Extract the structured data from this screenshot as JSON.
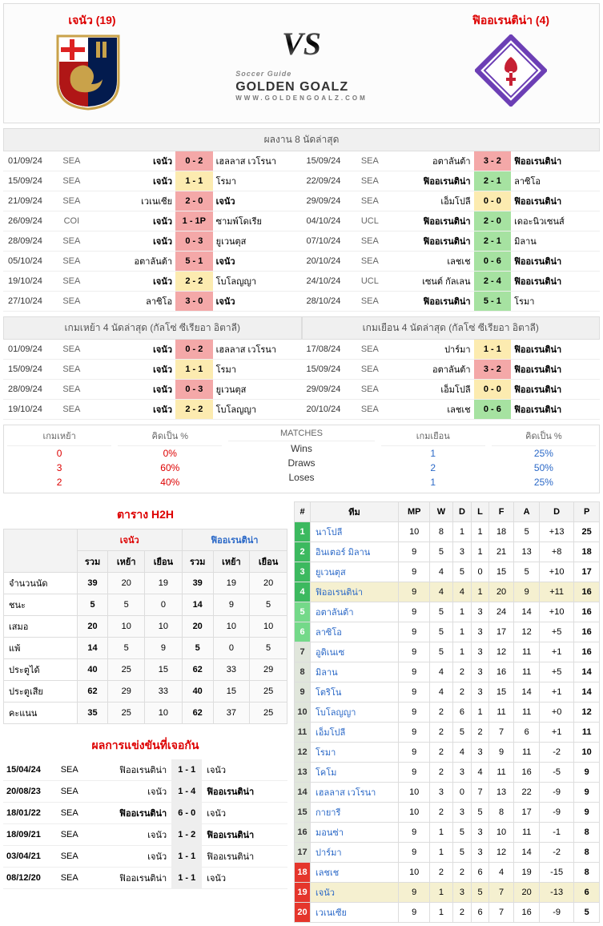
{
  "header": {
    "home_name": "เจนัว (19)",
    "away_name": "ฟิออเรนติน่า (4)",
    "vs": "VS",
    "site": "GOLDEN GOALZ",
    "site_sub": "WWW.GOLDENGOALZ.COM",
    "soccer_guide": "Soccer Guide"
  },
  "sections": {
    "last8": "ผลงาน 8 นัดล่าสุด",
    "home4": "เกมเหย้า 4 นัดล่าสุด (กัลโซ่ ซีเรียอา อิตาลี)",
    "away4": "เกมเยือน 4 นัดล่าสุด (กัลโซ่ ซีเรียอา อิตาลี)",
    "h2h_title": "ตาราง H2H",
    "h2h_matches_title": "ผลการแข่งขันที่เจอกัน"
  },
  "last8": {
    "home": [
      {
        "date": "01/09/24",
        "comp": "SEA",
        "l": "เจนัว",
        "s": "0 - 2",
        "r": "เฮลลาส เวโรนา",
        "cls": "s-red",
        "bold": "l"
      },
      {
        "date": "15/09/24",
        "comp": "SEA",
        "l": "เจนัว",
        "s": "1 - 1",
        "r": "โรมา",
        "cls": "s-yellow",
        "bold": "l"
      },
      {
        "date": "21/09/24",
        "comp": "SEA",
        "l": "เวเนเซีย",
        "s": "2 - 0",
        "r": "เจนัว",
        "cls": "s-red",
        "bold": "r"
      },
      {
        "date": "26/09/24",
        "comp": "COI",
        "l": "เจนัว",
        "s": "1 - 1P",
        "r": "ซามพ์โดเรีย",
        "cls": "s-red",
        "bold": "l"
      },
      {
        "date": "28/09/24",
        "comp": "SEA",
        "l": "เจนัว",
        "s": "0 - 3",
        "r": "ยูเวนตุส",
        "cls": "s-red",
        "bold": "l"
      },
      {
        "date": "05/10/24",
        "comp": "SEA",
        "l": "อตาลันต้า",
        "s": "5 - 1",
        "r": "เจนัว",
        "cls": "s-red",
        "bold": "r"
      },
      {
        "date": "19/10/24",
        "comp": "SEA",
        "l": "เจนัว",
        "s": "2 - 2",
        "r": "โบโลญญา",
        "cls": "s-yellow",
        "bold": "l"
      },
      {
        "date": "27/10/24",
        "comp": "SEA",
        "l": "ลาซิโอ",
        "s": "3 - 0",
        "r": "เจนัว",
        "cls": "s-red",
        "bold": "r"
      }
    ],
    "away": [
      {
        "date": "15/09/24",
        "comp": "SEA",
        "l": "อตาลันต้า",
        "s": "3 - 2",
        "r": "ฟิออเรนติน่า",
        "cls": "s-red",
        "bold": "r"
      },
      {
        "date": "22/09/24",
        "comp": "SEA",
        "l": "ฟิออเรนติน่า",
        "s": "2 - 1",
        "r": "ลาซิโอ",
        "cls": "s-green",
        "bold": "l"
      },
      {
        "date": "29/09/24",
        "comp": "SEA",
        "l": "เอ็มโปลี",
        "s": "0 - 0",
        "r": "ฟิออเรนติน่า",
        "cls": "s-yellow",
        "bold": "r"
      },
      {
        "date": "04/10/24",
        "comp": "UCL",
        "l": "ฟิออเรนติน่า",
        "s": "2 - 0",
        "r": "เดอะนิวเซนส์",
        "cls": "s-green",
        "bold": "l"
      },
      {
        "date": "07/10/24",
        "comp": "SEA",
        "l": "ฟิออเรนติน่า",
        "s": "2 - 1",
        "r": "มิลาน",
        "cls": "s-green",
        "bold": "l"
      },
      {
        "date": "20/10/24",
        "comp": "SEA",
        "l": "เลชเช",
        "s": "0 - 6",
        "r": "ฟิออเรนติน่า",
        "cls": "s-green",
        "bold": "r"
      },
      {
        "date": "24/10/24",
        "comp": "UCL",
        "l": "เซนต์ กัลเลน",
        "s": "2 - 4",
        "r": "ฟิออเรนติน่า",
        "cls": "s-green",
        "bold": "r"
      },
      {
        "date": "28/10/24",
        "comp": "SEA",
        "l": "ฟิออเรนติน่า",
        "s": "5 - 1",
        "r": "โรมา",
        "cls": "s-green",
        "bold": "l"
      }
    ]
  },
  "home4": [
    {
      "date": "01/09/24",
      "comp": "SEA",
      "l": "เจนัว",
      "s": "0 - 2",
      "r": "เฮลลาส เวโรนา",
      "cls": "s-red",
      "bold": "l"
    },
    {
      "date": "15/09/24",
      "comp": "SEA",
      "l": "เจนัว",
      "s": "1 - 1",
      "r": "โรมา",
      "cls": "s-yellow",
      "bold": "l"
    },
    {
      "date": "28/09/24",
      "comp": "SEA",
      "l": "เจนัว",
      "s": "0 - 3",
      "r": "ยูเวนตุส",
      "cls": "s-red",
      "bold": "l"
    },
    {
      "date": "19/10/24",
      "comp": "SEA",
      "l": "เจนัว",
      "s": "2 - 2",
      "r": "โบโลญญา",
      "cls": "s-yellow",
      "bold": "l"
    }
  ],
  "away4": [
    {
      "date": "17/08/24",
      "comp": "SEA",
      "l": "ปาร์มา",
      "s": "1 - 1",
      "r": "ฟิออเรนติน่า",
      "cls": "s-yellow",
      "bold": "r"
    },
    {
      "date": "15/09/24",
      "comp": "SEA",
      "l": "อตาลันต้า",
      "s": "3 - 2",
      "r": "ฟิออเรนติน่า",
      "cls": "s-red",
      "bold": "r"
    },
    {
      "date": "29/09/24",
      "comp": "SEA",
      "l": "เอ็มโปลี",
      "s": "0 - 0",
      "r": "ฟิออเรนติน่า",
      "cls": "s-yellow",
      "bold": "r"
    },
    {
      "date": "20/10/24",
      "comp": "SEA",
      "l": "เลชเช",
      "s": "0 - 6",
      "r": "ฟิออเรนติน่า",
      "cls": "s-green",
      "bold": "r"
    }
  ],
  "summary": {
    "labels": {
      "home": "เกมเหย้า",
      "pct": "คิดเป็น %",
      "matches": "MATCHES",
      "away": "เกมเยือน"
    },
    "rows": [
      {
        "h": "0",
        "hp": "0%",
        "m": "Wins",
        "a": "1",
        "ap": "25%"
      },
      {
        "h": "3",
        "hp": "60%",
        "m": "Draws",
        "a": "2",
        "ap": "50%"
      },
      {
        "h": "2",
        "hp": "40%",
        "m": "Loses",
        "a": "1",
        "ap": "25%"
      }
    ]
  },
  "h2h": {
    "teams": {
      "home": "เจนัว",
      "away": "ฟิออเรนติน่า"
    },
    "cols": {
      "total": "รวม",
      "home": "เหย้า",
      "away": "เยือน"
    },
    "rows": [
      {
        "lbl": "จำนวนนัด",
        "h": [
          "39",
          "20",
          "19"
        ],
        "a": [
          "39",
          "19",
          "20"
        ]
      },
      {
        "lbl": "ชนะ",
        "h": [
          "5",
          "5",
          "0"
        ],
        "a": [
          "14",
          "9",
          "5"
        ]
      },
      {
        "lbl": "เสมอ",
        "h": [
          "20",
          "10",
          "10"
        ],
        "a": [
          "20",
          "10",
          "10"
        ]
      },
      {
        "lbl": "แพ้",
        "h": [
          "14",
          "5",
          "9"
        ],
        "a": [
          "5",
          "0",
          "5"
        ]
      },
      {
        "lbl": "ประตูได้",
        "h": [
          "40",
          "25",
          "15"
        ],
        "a": [
          "62",
          "33",
          "29"
        ]
      },
      {
        "lbl": "ประตูเสีย",
        "h": [
          "62",
          "29",
          "33"
        ],
        "a": [
          "40",
          "15",
          "25"
        ]
      },
      {
        "lbl": "คะแนน",
        "h": [
          "35",
          "25",
          "10"
        ],
        "a": [
          "62",
          "37",
          "25"
        ]
      }
    ]
  },
  "h2h_matches": [
    {
      "date": "15/04/24",
      "comp": "SEA",
      "l": "ฟิออเรนติน่า",
      "s": "1 - 1",
      "r": "เจนัว"
    },
    {
      "date": "20/08/23",
      "comp": "SEA",
      "l": "เจนัว",
      "s": "1 - 4",
      "r": "ฟิออเรนติน่า",
      "rb": true
    },
    {
      "date": "18/01/22",
      "comp": "SEA",
      "l": "ฟิออเรนติน่า",
      "s": "6 - 0",
      "r": "เจนัว",
      "lb": true
    },
    {
      "date": "18/09/21",
      "comp": "SEA",
      "l": "เจนัว",
      "s": "1 - 2",
      "r": "ฟิออเรนติน่า",
      "rb": true
    },
    {
      "date": "03/04/21",
      "comp": "SEA",
      "l": "เจนัว",
      "s": "1 - 1",
      "r": "ฟิออเรนติน่า"
    },
    {
      "date": "08/12/20",
      "comp": "SEA",
      "l": "ฟิออเรนติน่า",
      "s": "1 - 1",
      "r": "เจนัว"
    }
  ],
  "standings": {
    "headers": {
      "pos": "#",
      "team": "ทีม",
      "mp": "MP",
      "w": "W",
      "d": "D",
      "l": "L",
      "f": "F",
      "a": "A",
      "gd": "D",
      "p": "P"
    },
    "rows": [
      {
        "pos": 1,
        "cls": "pos-g",
        "team": "นาโปลี",
        "mp": 10,
        "w": 8,
        "d": 1,
        "l": 1,
        "f": 18,
        "a": 5,
        "gd": "+13",
        "p": 25
      },
      {
        "pos": 2,
        "cls": "pos-g",
        "team": "อินเตอร์ มิลาน",
        "mp": 9,
        "w": 5,
        "d": 3,
        "l": 1,
        "f": 21,
        "a": 13,
        "gd": "+8",
        "p": 18
      },
      {
        "pos": 3,
        "cls": "pos-g",
        "team": "ยูเวนตุส",
        "mp": 9,
        "w": 4,
        "d": 5,
        "l": 0,
        "f": 15,
        "a": 5,
        "gd": "+10",
        "p": 17
      },
      {
        "pos": 4,
        "cls": "pos-g",
        "team": "ฟิออเรนติน่า",
        "mp": 9,
        "w": 4,
        "d": 4,
        "l": 1,
        "f": 20,
        "a": 9,
        "gd": "+11",
        "p": 16,
        "hi": true
      },
      {
        "pos": 5,
        "cls": "pos-lg",
        "team": "อตาลันต้า",
        "mp": 9,
        "w": 5,
        "d": 1,
        "l": 3,
        "f": 24,
        "a": 14,
        "gd": "+10",
        "p": 16
      },
      {
        "pos": 6,
        "cls": "pos-lg",
        "team": "ลาซิโอ",
        "mp": 9,
        "w": 5,
        "d": 1,
        "l": 3,
        "f": 17,
        "a": 12,
        "gd": "+5",
        "p": 16
      },
      {
        "pos": 7,
        "cls": "pos-gray",
        "team": "อูดิเนเซ",
        "mp": 9,
        "w": 5,
        "d": 1,
        "l": 3,
        "f": 12,
        "a": 11,
        "gd": "+1",
        "p": 16
      },
      {
        "pos": 8,
        "cls": "pos-gray",
        "team": "มิลาน",
        "mp": 9,
        "w": 4,
        "d": 2,
        "l": 3,
        "f": 16,
        "a": 11,
        "gd": "+5",
        "p": 14
      },
      {
        "pos": 9,
        "cls": "pos-gray",
        "team": "โตริโน",
        "mp": 9,
        "w": 4,
        "d": 2,
        "l": 3,
        "f": 15,
        "a": 14,
        "gd": "+1",
        "p": 14
      },
      {
        "pos": 10,
        "cls": "pos-gray",
        "team": "โบโลญญา",
        "mp": 9,
        "w": 2,
        "d": 6,
        "l": 1,
        "f": 11,
        "a": 11,
        "gd": "+0",
        "p": 12
      },
      {
        "pos": 11,
        "cls": "pos-gray",
        "team": "เอ็มโปลี",
        "mp": 9,
        "w": 2,
        "d": 5,
        "l": 2,
        "f": 7,
        "a": 6,
        "gd": "+1",
        "p": 11
      },
      {
        "pos": 12,
        "cls": "pos-gray",
        "team": "โรมา",
        "mp": 9,
        "w": 2,
        "d": 4,
        "l": 3,
        "f": 9,
        "a": 11,
        "gd": "-2",
        "p": 10
      },
      {
        "pos": 13,
        "cls": "pos-gray",
        "team": "โคโม",
        "mp": 9,
        "w": 2,
        "d": 3,
        "l": 4,
        "f": 11,
        "a": 16,
        "gd": "-5",
        "p": 9
      },
      {
        "pos": 14,
        "cls": "pos-gray",
        "team": "เฮลลาส เวโรนา",
        "mp": 10,
        "w": 3,
        "d": 0,
        "l": 7,
        "f": 13,
        "a": 22,
        "gd": "-9",
        "p": 9
      },
      {
        "pos": 15,
        "cls": "pos-gray",
        "team": "กายารี",
        "mp": 10,
        "w": 2,
        "d": 3,
        "l": 5,
        "f": 8,
        "a": 17,
        "gd": "-9",
        "p": 9
      },
      {
        "pos": 16,
        "cls": "pos-gray",
        "team": "มอนซ่า",
        "mp": 9,
        "w": 1,
        "d": 5,
        "l": 3,
        "f": 10,
        "a": 11,
        "gd": "-1",
        "p": 8
      },
      {
        "pos": 17,
        "cls": "pos-gray",
        "team": "ปาร์มา",
        "mp": 9,
        "w": 1,
        "d": 5,
        "l": 3,
        "f": 12,
        "a": 14,
        "gd": "-2",
        "p": 8
      },
      {
        "pos": 18,
        "cls": "pos-red",
        "team": "เลชเช",
        "mp": 10,
        "w": 2,
        "d": 2,
        "l": 6,
        "f": 4,
        "a": 19,
        "gd": "-15",
        "p": 8
      },
      {
        "pos": 19,
        "cls": "pos-red",
        "team": "เจนัว",
        "mp": 9,
        "w": 1,
        "d": 3,
        "l": 5,
        "f": 7,
        "a": 20,
        "gd": "-13",
        "p": 6,
        "hi": true
      },
      {
        "pos": 20,
        "cls": "pos-red",
        "team": "เวเนเซีย",
        "mp": 9,
        "w": 1,
        "d": 2,
        "l": 6,
        "f": 7,
        "a": 16,
        "gd": "-9",
        "p": 5
      }
    ]
  }
}
